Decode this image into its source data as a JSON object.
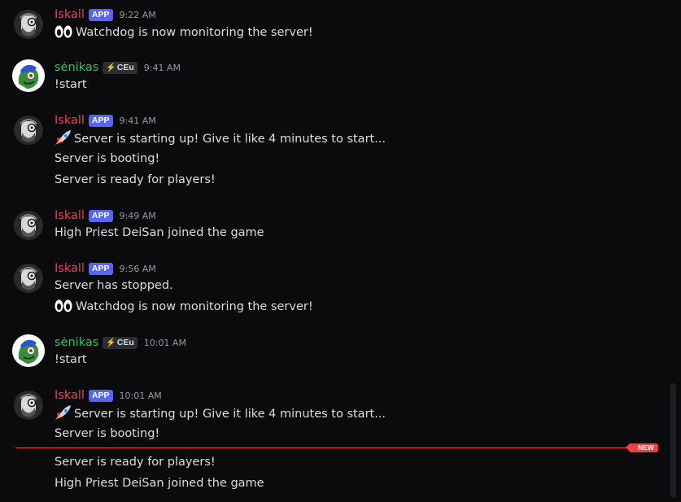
{
  "messages": [
    {
      "author": "Iskall",
      "tag": "APP",
      "time": "9:22 AM",
      "lines": [
        "👀 Watchdog is now monitoring the server!"
      ]
    },
    {
      "author": "sėnikas",
      "guild_tag": "CEu",
      "time": "9:41 AM",
      "lines": [
        "!start"
      ]
    },
    {
      "author": "Iskall",
      "tag": "APP",
      "time": "9:41 AM",
      "lines": [
        "🚀 Server is starting up! Give it like 4 minutes to start...",
        "Server is booting!",
        "Server is ready for players!"
      ]
    },
    {
      "author": "Iskall",
      "tag": "APP",
      "time": "9:49 AM",
      "lines": [
        "High Priest DeiSan joined the game"
      ]
    },
    {
      "author": "Iskall",
      "tag": "APP",
      "time": "9:56 AM",
      "lines": [
        "Server has stopped.",
        "👀 Watchdog is now monitoring the server!"
      ]
    },
    {
      "author": "sėnikas",
      "guild_tag": "CEu",
      "time": "10:01 AM",
      "lines": [
        "!start"
      ]
    },
    {
      "author": "Iskall",
      "tag": "APP",
      "time": "10:01 AM",
      "lines": [
        "🚀 Server is starting up! Give it like 4 minutes to start...",
        "Server is booting!",
        "Server is ready for players!",
        "High Priest DeiSan joined the game"
      ]
    }
  ],
  "text": {
    "m0l0": "Watchdog is now monitoring the server!",
    "m2l0": "Server is starting up! Give it like 4 minutes to start...",
    "m4l1": "Watchdog is now monitoring the server!",
    "m6l0": "Server is starting up! Give it like 4 minutes to start..."
  },
  "new_divider_label": "NEW",
  "colors": {
    "bot_name": "#e8435f",
    "user_name": "#3fbf5f",
    "app_tag": "#5865f2",
    "new_divider": "#f23f43",
    "background": "#0b0b0d"
  }
}
